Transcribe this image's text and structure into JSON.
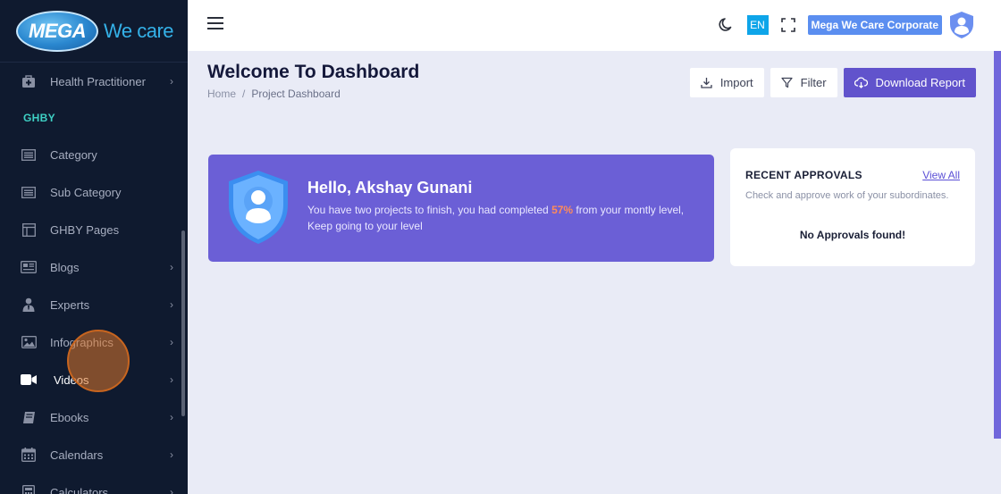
{
  "brand": {
    "logo_text": "MEGA",
    "tagline": "We care"
  },
  "sidebar": {
    "items": [
      {
        "label": "Health Practitioner",
        "icon": "medical-bag-icon",
        "chevron": "›"
      },
      {
        "label": "Category",
        "icon": "list-icon",
        "chevron": ""
      },
      {
        "label": "Sub Category",
        "icon": "list-icon",
        "chevron": ""
      },
      {
        "label": "GHBY Pages",
        "icon": "layout-icon",
        "chevron": ""
      },
      {
        "label": "Blogs",
        "icon": "newspaper-icon",
        "chevron": "›"
      },
      {
        "label": "Experts",
        "icon": "user-tie-icon",
        "chevron": "›"
      },
      {
        "label": "Infographics",
        "icon": "image-icon",
        "chevron": "›"
      },
      {
        "label": "Videos",
        "icon": "video-icon",
        "chevron": "›"
      },
      {
        "label": "Ebooks",
        "icon": "book-icon",
        "chevron": "›"
      },
      {
        "label": "Calendars",
        "icon": "calendar-icon",
        "chevron": "›"
      },
      {
        "label": "Calculators",
        "icon": "calculator-icon",
        "chevron": "›"
      }
    ],
    "section_title": "GHBY",
    "active_item": "Videos"
  },
  "topbar": {
    "language": "EN",
    "organization": "Mega We Care Corporate"
  },
  "page": {
    "title": "Welcome To Dashboard",
    "breadcrumb": {
      "home": "Home",
      "separator": "/",
      "current": "Project Dashboard"
    }
  },
  "actions": {
    "import_label": "Import",
    "filter_label": "Filter",
    "download_label": "Download Report"
  },
  "hello_card": {
    "name": "Hello, Akshay Gunani",
    "msg_before": "You have two projects to finish, you had completed ",
    "percent": "57%",
    "msg_after": " from your montly level, Keep going to your level"
  },
  "approvals": {
    "title": "RECENT APPROVALS",
    "view_all": "View All",
    "subtitle": "Check and approve work of your subordinates.",
    "empty": "No Approvals found!"
  },
  "colors": {
    "sidebar_bg": "#0f1a2f",
    "accent": "#6153cc",
    "section_title": "#3ed0c4",
    "highlight_percent": "#ff8b5a",
    "language_badge": "#0ea5e9",
    "org_badge": "#5b8ef0"
  }
}
